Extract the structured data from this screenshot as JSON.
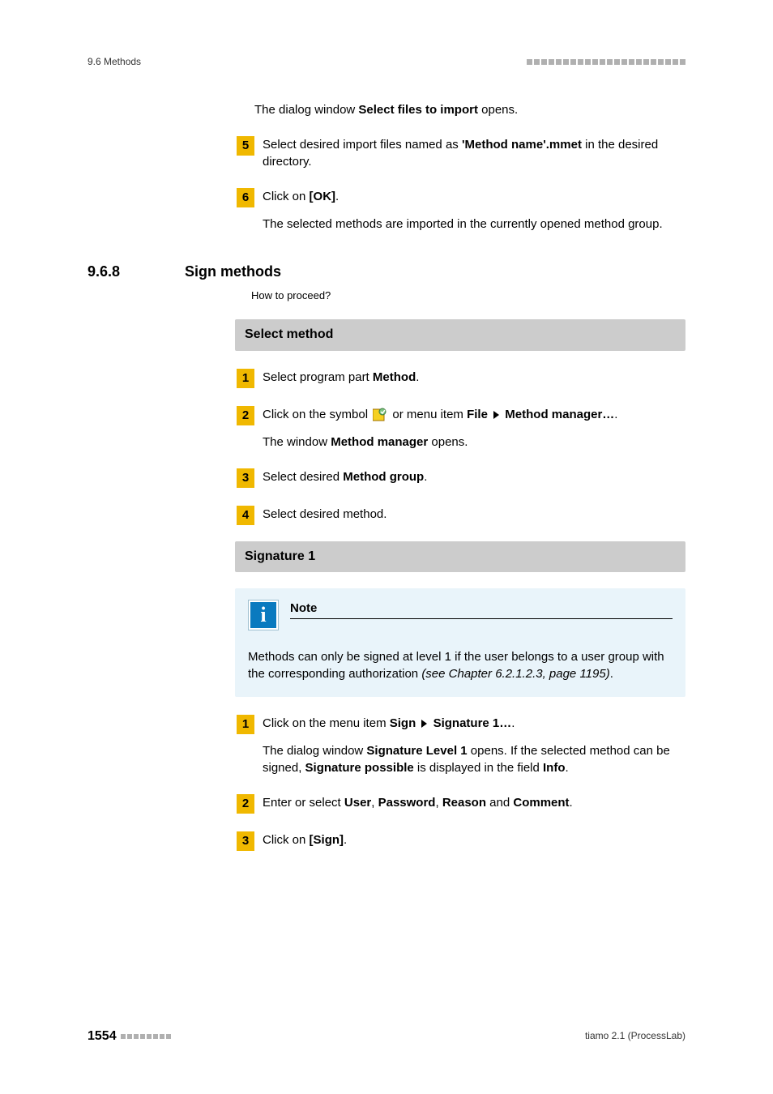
{
  "header": {
    "left": "9.6 Methods"
  },
  "intro_para_pre": "The dialog window ",
  "intro_bold": "Select files to import",
  "intro_para_post": " opens.",
  "step5": {
    "num": "5",
    "pre": "Select desired import files named as ",
    "bold": "'Method name'.mmet",
    "post": " in the desired directory."
  },
  "step6": {
    "num": "6",
    "pre": "Click on ",
    "bold": "[OK]",
    "post": ".",
    "sub": "The selected methods are imported in the currently opened method group."
  },
  "section": {
    "num": "9.6.8",
    "title": "Sign methods",
    "how": "How to proceed?"
  },
  "bar1": "Select method",
  "sm1": {
    "num": "1",
    "pre": "Select program part ",
    "bold": "Method",
    "post": "."
  },
  "sm2": {
    "num": "2",
    "pre": "Click on the symbol ",
    "mid": " or menu item ",
    "b1": "File",
    "b2": "Method manager…",
    "post": ".",
    "sub_pre": "The window ",
    "sub_b": "Method manager",
    "sub_post": " opens."
  },
  "sm3": {
    "num": "3",
    "pre": "Select desired ",
    "bold": "Method group",
    "post": "."
  },
  "sm4": {
    "num": "4",
    "txt": "Select desired method."
  },
  "bar2": "Signature 1",
  "note": {
    "label": "Note",
    "text_pre": "Methods can only be signed at level 1 if the user belongs to a user group with the corresponding authorization ",
    "text_it": "(see Chapter 6.2.1.2.3, page 1195)",
    "text_post": "."
  },
  "sig1": {
    "num": "1",
    "pre": "Click on the menu item ",
    "b1": "Sign",
    "b2": "Signature 1…",
    "post": ".",
    "sub_pre": "The dialog window ",
    "sub_b1": "Signature Level 1",
    "sub_mid": " opens. If the selected method can be signed, ",
    "sub_b2": "Signature possible",
    "sub_mid2": " is displayed in the field ",
    "sub_b3": "Info",
    "sub_post": "."
  },
  "sig2": {
    "num": "2",
    "pre": "Enter or select ",
    "b1": "User",
    "c1": ", ",
    "b2": "Password",
    "c2": ", ",
    "b3": "Reason",
    "c3": " and ",
    "b4": "Comment",
    "post": "."
  },
  "sig3": {
    "num": "3",
    "pre": "Click on ",
    "bold": "[Sign]",
    "post": "."
  },
  "footer": {
    "page": "1554",
    "right": "tiamo 2.1 (ProcessLab)"
  }
}
